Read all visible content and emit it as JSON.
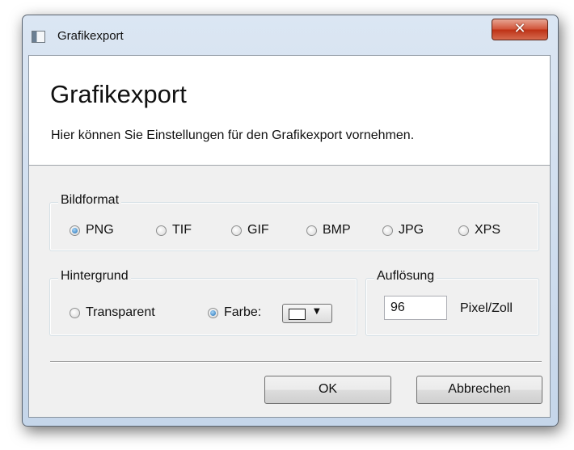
{
  "window": {
    "title": "Grafikexport",
    "close_symbol": "✕"
  },
  "header": {
    "title": "Grafikexport",
    "subtitle": "Hier können Sie Einstellungen für den Grafikexport vornehmen."
  },
  "bildformat": {
    "label": "Bildformat",
    "options": [
      {
        "label": "PNG",
        "checked": true
      },
      {
        "label": "TIF",
        "checked": false
      },
      {
        "label": "GIF",
        "checked": false
      },
      {
        "label": "BMP",
        "checked": false
      },
      {
        "label": "JPG",
        "checked": false
      },
      {
        "label": "XPS",
        "checked": false
      }
    ]
  },
  "hintergrund": {
    "label": "Hintergrund",
    "options": [
      {
        "label": "Transparent",
        "checked": false
      },
      {
        "label": "Farbe:",
        "checked": true
      }
    ],
    "color_value": "#ffffff",
    "arrow_symbol": "▼"
  },
  "aufloesung": {
    "label": "Auflösung",
    "value": "96",
    "unit": "Pixel/Zoll"
  },
  "buttons": {
    "ok": "OK",
    "cancel": "Abbrechen"
  },
  "icons": {
    "app": "window-app-icon",
    "close": "close-icon",
    "dropdown": "chevron-down-icon"
  }
}
